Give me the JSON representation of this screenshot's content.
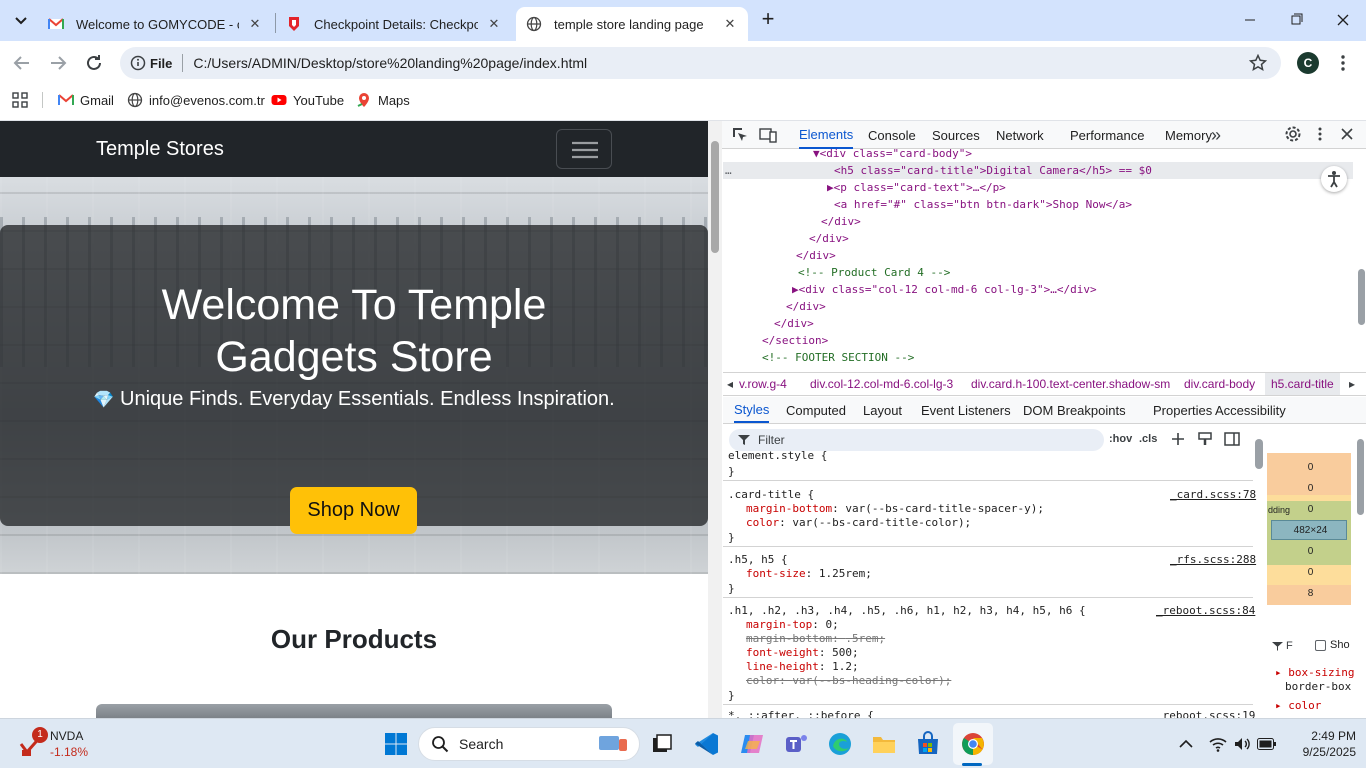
{
  "browser": {
    "tabs": [
      {
        "title": "Welcome to GOMYCODE - chiji",
        "icon": "gmail-icon"
      },
      {
        "title": "Checkpoint Details: Checkpoint",
        "icon": "gomycode-icon"
      },
      {
        "title": "temple store landing page",
        "icon": "globe-icon",
        "active": true
      }
    ],
    "new_tab_symbol": "+",
    "address": {
      "scheme_label": "File",
      "url": "C:/Users/ADMIN/Desktop/store%20landing%20page/index.html"
    },
    "profile_initial": "C",
    "bookmarks": [
      "Gmail",
      "info@evenos.com.tr",
      "YouTube",
      "Maps"
    ]
  },
  "page": {
    "brand": "Temple Stores",
    "hero": {
      "title_line1": "Welcome To Temple",
      "title_line2": "Gadgets Store",
      "tagline": "Unique Finds. Everyday Essentials. Endless Inspiration.",
      "tagline_icon": "💎",
      "cta": "Shop Now"
    },
    "products_heading": "Our Products"
  },
  "devtools": {
    "tabs": [
      "Elements",
      "Console",
      "Sources",
      "Network",
      "Performance",
      "Memory"
    ],
    "active_tab": "Elements",
    "more_tabs": "»",
    "dom_lines": [
      {
        "indent": 0,
        "html": "▼<div class=\"card-body\">"
      },
      {
        "indent": 1,
        "html": "<h5 class=\"card-title\">Digital Camera</h5> == $0"
      },
      {
        "indent": 1,
        "html": "▶<p class=\"card-text\">…</p>"
      },
      {
        "indent": 1,
        "html": "<a href=\"#\" class=\"btn btn-dark\">Shop Now</a>"
      },
      {
        "indent": 0,
        "html": "</div>"
      },
      {
        "indent": 0,
        "html": "</div>"
      },
      {
        "indent": 0,
        "html": "</div>"
      },
      {
        "indent": 0,
        "html": "<!-- Product Card 4 -->"
      },
      {
        "indent": 0,
        "html": "▶<div class=\"col-12 col-md-6 col-lg-3\">…</div>"
      },
      {
        "indent": 0,
        "html": "</div>"
      },
      {
        "indent": 0,
        "html": "</div>"
      },
      {
        "indent": 0,
        "html": "</section>"
      },
      {
        "indent": 0,
        "html": "<!-- FOOTER SECTION -->"
      }
    ],
    "breadcrumbs": [
      "v.row.g-4",
      "div.col-12.col-md-6.col-lg-3",
      "div.card.h-100.text-center.shadow-sm",
      "div.card-body",
      "h5.card-title"
    ],
    "sub_tabs": [
      "Styles",
      "Computed",
      "Layout",
      "Event Listeners",
      "DOM Breakpoints",
      "Properties",
      "Accessibility"
    ],
    "filter_placeholder": "Filter",
    "hov": ":hov",
    "cls": ".cls",
    "rules": [
      {
        "selector": "element.style {",
        "source": "",
        "props": []
      },
      {
        "selector": ".card-title {",
        "source": "_card.scss:78",
        "props": [
          {
            "name": "margin-bottom",
            "value": "var(--bs-card-title-spacer-y);",
            "struck": false
          },
          {
            "name": "color",
            "value": "var(--bs-card-title-color);",
            "struck": false
          }
        ]
      },
      {
        "selector": ".h5, h5 {",
        "source": "_rfs.scss:288",
        "props": [
          {
            "name": "font-size",
            "value": "1.25rem;",
            "struck": false
          }
        ]
      },
      {
        "selector": ".h1, .h2, .h3, .h4, .h5, .h6, h1, h2, h3, h4, h5, h6 {",
        "source": "_reboot.scss:84",
        "props": [
          {
            "name": "margin-top",
            "value": "0;",
            "struck": false
          },
          {
            "name": "margin-bottom",
            "value": ".5rem;",
            "struck": true
          },
          {
            "name": "font-weight",
            "value": "500;",
            "struck": false
          },
          {
            "name": "line-height",
            "value": "1.2;",
            "struck": false
          },
          {
            "name": "color",
            "value": "var(--bs-heading-color);",
            "struck": true
          }
        ]
      },
      {
        "selector": "*, ::after, ::before {",
        "source": "_reboot.scss:19",
        "props": []
      }
    ],
    "box_model": {
      "values": [
        "0",
        "0",
        "0",
        "482×24",
        "0",
        "0",
        "8"
      ],
      "padding_label": "dding"
    },
    "computed": {
      "filter": "F",
      "show_all": "Sho",
      "props": [
        "box-sizing",
        "border-box",
        "color"
      ]
    }
  },
  "taskbar": {
    "stock": {
      "name": "NVDA",
      "change": "-1.18%",
      "badge": "1"
    },
    "search_label": "Search",
    "time": "2:49 PM",
    "date": "9/25/2025"
  }
}
